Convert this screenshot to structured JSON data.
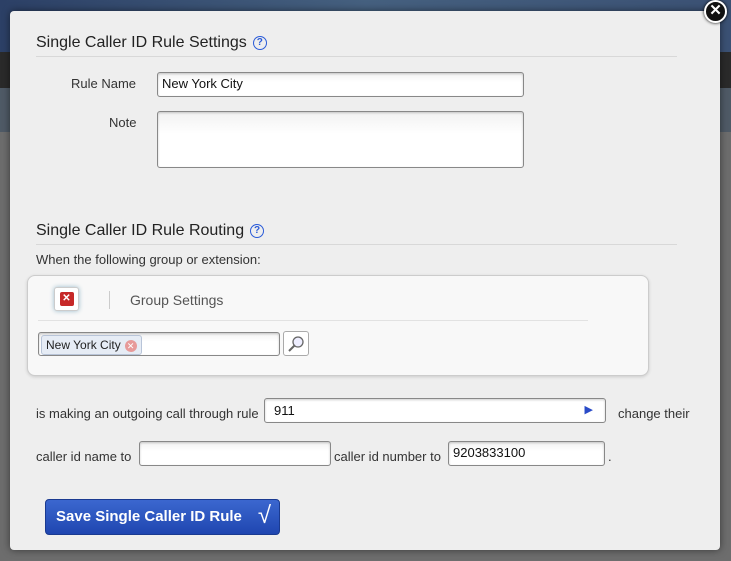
{
  "settings": {
    "title": "Single Caller ID Rule Settings",
    "rule_name_label": "Rule Name",
    "rule_name_value": "New York City",
    "note_label": "Note",
    "note_value": ""
  },
  "routing": {
    "title": "Single Caller ID Rule Routing",
    "intro": "When the following group or extension:",
    "group_settings": "Group Settings",
    "selected_tag": "New York City",
    "rule_prefix": "is making an outgoing call through rule",
    "rule_value": "911",
    "rule_suffix": "change their",
    "name_prefix": "caller id name to",
    "name_value": "",
    "number_prefix": "caller id number to",
    "number_value": "9203833100",
    "end": "."
  },
  "save_label": "Save Single Caller ID Rule",
  "icons": {
    "help": "?",
    "close": "✕",
    "remove": "✕",
    "search": "magnifier",
    "arrow": "▶",
    "check": "√"
  }
}
